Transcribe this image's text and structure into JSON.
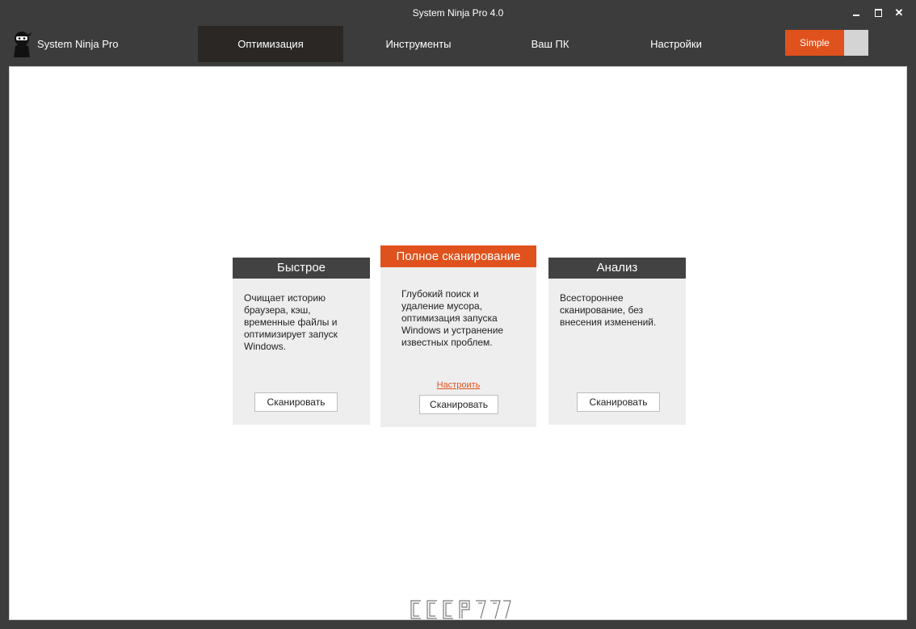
{
  "window": {
    "title": "System Ninja Pro 4.0"
  },
  "brand": {
    "name": "System Ninja Pro",
    "icon": "ninja-logo-icon"
  },
  "nav": {
    "tabs": [
      {
        "label": "Оптимизация",
        "active": true
      },
      {
        "label": "Инструменты",
        "active": false
      },
      {
        "label": "Ваш ПК",
        "active": false
      },
      {
        "label": "Настройки",
        "active": false
      }
    ],
    "mode_toggle": {
      "label": "Simple",
      "on": true
    }
  },
  "cards": {
    "quick": {
      "title": "Быстрое",
      "description": "Очищает историю браузера, кэш, временные файлы и оптимизирует запуск Windows.",
      "button": "Сканировать"
    },
    "full": {
      "title": "Полное сканирование",
      "description": "Глубокий поиск и удаление мусора, оптимизация запуска Windows и устранение известных проблем.",
      "link": "Настроить",
      "button": "Сканировать"
    },
    "analysis": {
      "title": "Анализ",
      "description": "Всестороннее сканирование, без внесения изменений.",
      "button": "Сканировать"
    }
  },
  "watermark": {
    "text": "CCCP777"
  },
  "colors": {
    "accent": "#e0521d",
    "dark": "#3c3c3c",
    "card": "#eeeeee",
    "card_header": "#424242"
  }
}
